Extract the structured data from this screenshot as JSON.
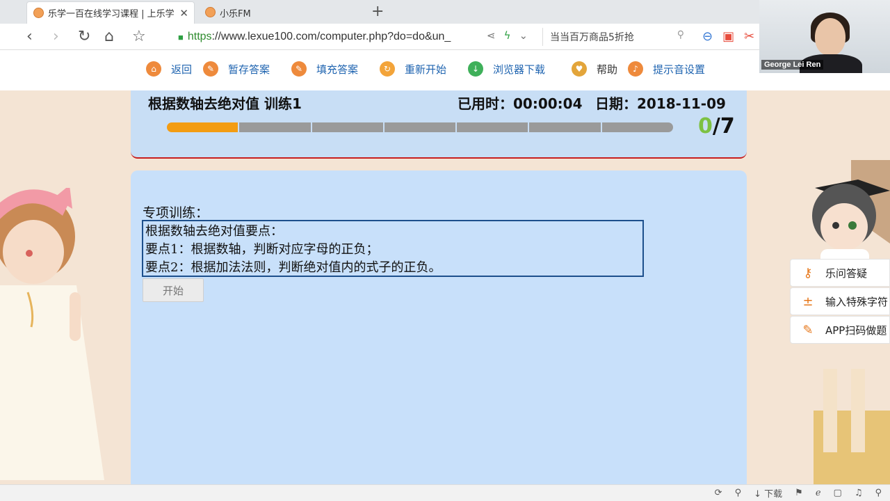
{
  "browser": {
    "tabs": [
      {
        "label": "乐学一百在线学习课程 | 上乐学",
        "active": true
      },
      {
        "label": "小乐FM",
        "active": false
      }
    ],
    "new_tab": "+",
    "url_scheme": "https",
    "url_rest": "://www.lexue100.com/computer.php?do=do&un_",
    "search_text": "当当百万商品5折抢"
  },
  "site_toolbar": {
    "back": "返回",
    "save_answer": "暂存答案",
    "fill_answer": "填充答案",
    "restart": "重新开始",
    "download_browser": "浏览器下载",
    "help": "帮助",
    "sound_settings": "提示音设置"
  },
  "webcam": {
    "name": "George Lei Ren"
  },
  "exercise": {
    "title": "根据数轴去绝对值 训练1",
    "elapsed_label": "已用时：",
    "elapsed_value": "00:00:04",
    "date_label": "日期：",
    "date_value": "2018-11-09",
    "progress_segments": 7,
    "progress_current": 1,
    "score_done": "0",
    "score_total": "/7"
  },
  "content": {
    "section_label": "专项训练：",
    "points": [
      "根据数轴去绝对值要点：",
      "要点1：根据数轴，判断对应字母的正负；",
      "要点2：根据加法法则，判断绝对值内的式子的正负。"
    ],
    "start_button": "开始"
  },
  "side_menu": {
    "ask": "乐问答疑",
    "special_chars": "输入特殊字符",
    "app_scan": "APP扫码做题"
  },
  "status_bar": {
    "download": "下载"
  },
  "colors": {
    "accent_orange": "#f39c12",
    "score_green": "#7dc142",
    "card_blue": "#c8e0fa",
    "link_blue": "#1f64b0"
  }
}
